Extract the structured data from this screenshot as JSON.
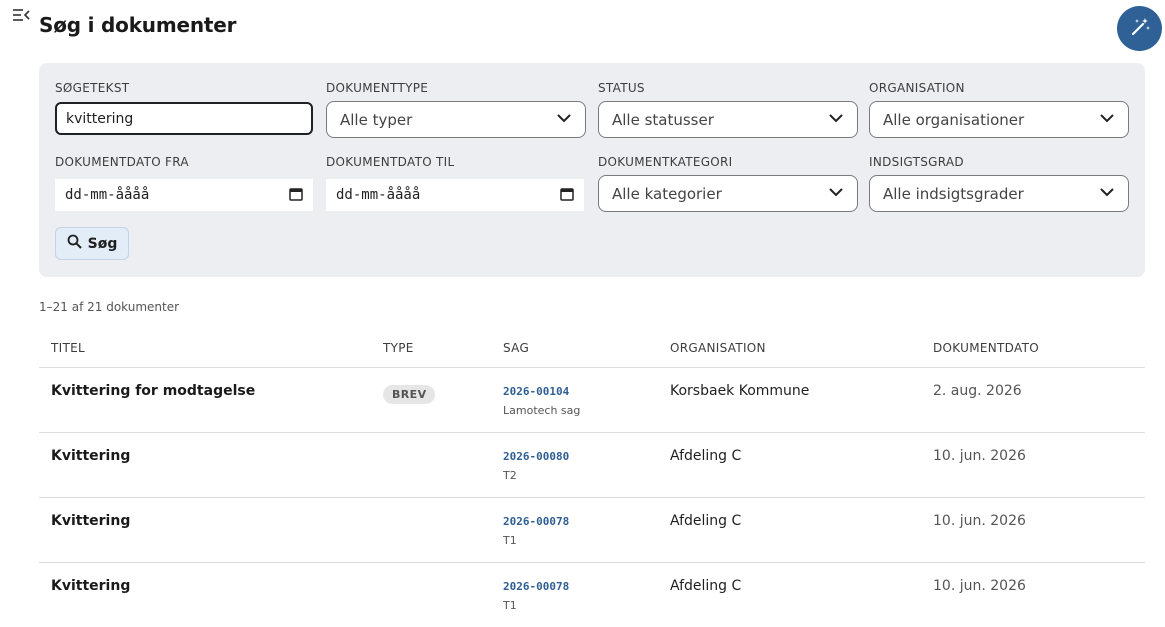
{
  "header": {
    "title": "Søg i dokumenter",
    "menu_icon": "menu-collapse-icon",
    "magic_icon": "magic-wand-icon",
    "accent": "#2f6196"
  },
  "filters": {
    "search_text": {
      "label": "SØGETEKST",
      "value": "kvittering"
    },
    "document_type": {
      "label": "DOKUMENTTYPE",
      "value": "Alle typer"
    },
    "status": {
      "label": "STATUS",
      "value": "Alle statusser"
    },
    "organisation": {
      "label": "ORGANISATION",
      "value": "Alle organisationer"
    },
    "date_from": {
      "label": "DOKUMENTDATO FRA",
      "value": "dd-mm-åååå"
    },
    "date_to": {
      "label": "DOKUMENTDATO TIL",
      "value": "dd-mm-åååå"
    },
    "category": {
      "label": "DOKUMENTKATEGORI",
      "value": "Alle kategorier"
    },
    "access_level": {
      "label": "INDSIGTSGRAD",
      "value": "Alle indsigtsgrader"
    },
    "search_button": "Søg"
  },
  "results": {
    "count_text": "1–21 af 21 dokumenter",
    "columns": {
      "title": "TITEL",
      "type": "TYPE",
      "case": "SAG",
      "organisation": "ORGANISATION",
      "date": "DOKUMENTDATO"
    },
    "rows": [
      {
        "title": "Kvittering for modtagelse",
        "type": "BREV",
        "case_number": "2026-00104",
        "case_name": "Lamotech sag",
        "organisation": "Korsbaek Kommune",
        "date": "2. aug. 2026"
      },
      {
        "title": "Kvittering",
        "type": "",
        "case_number": "2026-00080",
        "case_name": "T2",
        "organisation": "Afdeling C",
        "date": "10. jun. 2026"
      },
      {
        "title": "Kvittering",
        "type": "",
        "case_number": "2026-00078",
        "case_name": "T1",
        "organisation": "Afdeling C",
        "date": "10. jun. 2026"
      },
      {
        "title": "Kvittering",
        "type": "",
        "case_number": "2026-00078",
        "case_name": "T1",
        "organisation": "Afdeling C",
        "date": "10. jun. 2026"
      }
    ]
  }
}
